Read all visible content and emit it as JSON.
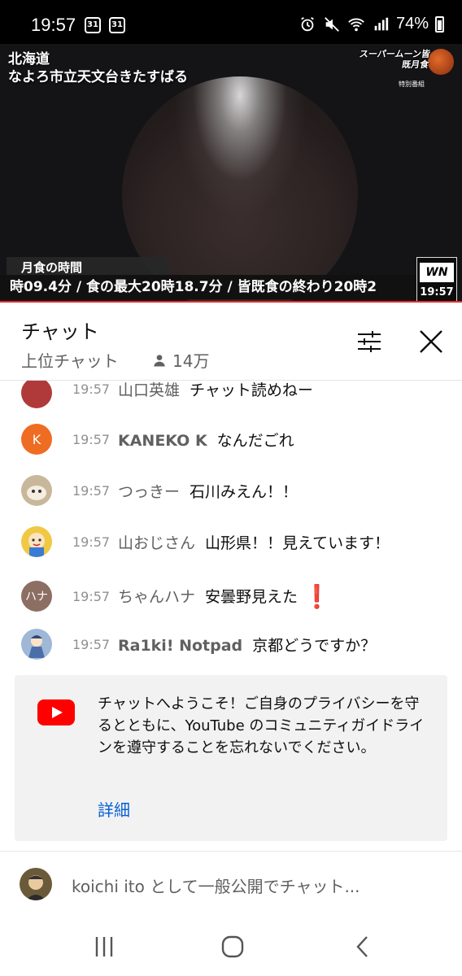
{
  "status_bar": {
    "time": "19:57",
    "calendar_icons": [
      "31",
      "31"
    ],
    "battery": "74%",
    "icons": [
      "alarm-icon",
      "mute-icon",
      "wifi-icon",
      "signal-icon",
      "battery-icon"
    ]
  },
  "video": {
    "location_line1": "北海道",
    "location_line2": "なよろ市立天文台きたすばる",
    "logo_text": "スーパームーン皆既月食",
    "logo_sub": "特別番組",
    "label": "月食の時間",
    "ticker": "時09.4分 / 食の最大20時18.7分 / 皆既食の終わり20時2",
    "channel_logo": "WN",
    "channel_time": "19:57"
  },
  "chat_header": {
    "title": "チャット",
    "mode": "上位チャット",
    "viewers": "14万"
  },
  "messages": [
    {
      "time": "19:57",
      "author": "山口英雄",
      "text": "チャット読めねー",
      "avatar_color": "#b03a3a",
      "avatar_letter": "",
      "bold": false,
      "excl": ""
    },
    {
      "time": "19:57",
      "author": "KANEKO K",
      "text": "なんだごれ",
      "avatar_color": "#ef6c23",
      "avatar_letter": "K",
      "bold": true,
      "excl": ""
    },
    {
      "time": "19:57",
      "author": "つっきー",
      "text": "石川みえん！！",
      "avatar_color": "#c8b79a",
      "avatar_letter": "",
      "bold": false,
      "excl": ""
    },
    {
      "time": "19:57",
      "author": "山おじさん",
      "text": "山形県！！見えています！",
      "avatar_color": "#f1c844",
      "avatar_letter": "",
      "bold": false,
      "excl": ""
    },
    {
      "time": "19:57",
      "author": "ちゃんハナ",
      "text": "安曇野見えた",
      "avatar_color": "#8d6e63",
      "avatar_letter": "ハナ",
      "bold": false,
      "excl": "❗"
    },
    {
      "time": "19:57",
      "author": "Ra1ki! Notpad",
      "text": "京都どうですか？",
      "avatar_color": "#9fb8d8",
      "avatar_letter": "",
      "bold": true,
      "excl": ""
    }
  ],
  "welcome": {
    "text": "チャットへようこそ！ご自身のプライバシーを守るとともに、YouTube のコミュニティガイドラインを遵守することを忘れないでください。",
    "link": "詳細"
  },
  "chat_input": {
    "placeholder": "koichi ito として一般公開でチャット..."
  },
  "colors": {
    "link": "#065fd4",
    "youtube_red": "#ff0000",
    "secondary_text": "#606060"
  }
}
